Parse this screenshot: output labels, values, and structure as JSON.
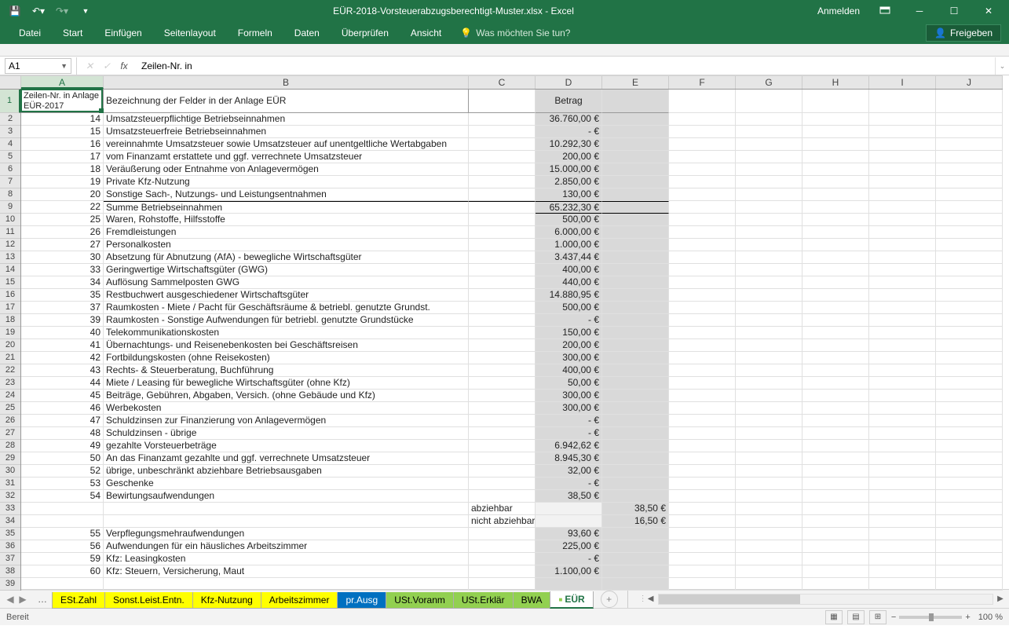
{
  "titlebar": {
    "title": "EÜR-2018-Vorsteuerabzugsberechtigt-Muster.xlsx  -  Excel",
    "login": "Anmelden"
  },
  "ribbon": {
    "tabs": [
      "Datei",
      "Start",
      "Einfügen",
      "Seitenlayout",
      "Formeln",
      "Daten",
      "Überprüfen",
      "Ansicht"
    ],
    "tell_me": "Was möchten Sie tun?",
    "share": "Freigeben"
  },
  "formula": {
    "name": "A1",
    "value": "Zeilen-Nr. in"
  },
  "columns": [
    "A",
    "B",
    "C",
    "D",
    "E",
    "F",
    "G",
    "H",
    "I",
    "J"
  ],
  "col_widths": [
    "col-A",
    "col-B",
    "col-C",
    "col-D",
    "col-E",
    "col-F",
    "col-G",
    "col-H",
    "col-I",
    "col-J"
  ],
  "header_row": {
    "A": "Zeilen-Nr. in Anlage EÜR-2017",
    "B": "Bezeichnung der Felder in der Anlage EÜR",
    "D": "Betrag"
  },
  "rows": [
    {
      "n": 2,
      "A": "14",
      "B": "Umsatzsteuerpflichtige Betriebseinnahmen",
      "D": "36.760,00 €"
    },
    {
      "n": 3,
      "A": "15",
      "B": "Umsatzsteuerfreie Betriebseinnahmen",
      "D": "-   €"
    },
    {
      "n": 4,
      "A": "16",
      "B": "vereinnahmte Umsatzsteuer sowie Umsatzsteuer auf unentgeltliche Wertabgaben",
      "D": "10.292,30 €"
    },
    {
      "n": 5,
      "A": "17",
      "B": "vom Finanzamt erstattete und ggf. verrechnete Umsatzsteuer",
      "D": "200,00 €"
    },
    {
      "n": 6,
      "A": "18",
      "B": "Veräußerung oder Entnahme von Anlagevermögen",
      "D": "15.000,00 €"
    },
    {
      "n": 7,
      "A": "19",
      "B": "Private Kfz-Nutzung",
      "D": "2.850,00 €"
    },
    {
      "n": 8,
      "A": "20",
      "B": "Sonstige Sach-, Nutzungs- und Leistungsentnahmen",
      "D": "130,00 €"
    },
    {
      "n": 9,
      "A": "22",
      "B": "Summe Betriebseinnahmen",
      "D": "65.232,30 €",
      "sum": true
    },
    {
      "n": 10,
      "A": "25",
      "B": "Waren, Rohstoffe, Hilfsstoffe",
      "D": "500,00 €"
    },
    {
      "n": 11,
      "A": "26",
      "B": "Fremdleistungen",
      "D": "6.000,00 €"
    },
    {
      "n": 12,
      "A": "27",
      "B": "Personalkosten",
      "D": "1.000,00 €"
    },
    {
      "n": 13,
      "A": "30",
      "B": "Absetzung für Abnutzung (AfA) - bewegliche Wirtschaftsgüter",
      "D": "3.437,44 €"
    },
    {
      "n": 14,
      "A": "33",
      "B": "Geringwertige Wirtschaftsgüter (GWG)",
      "D": "400,00 €"
    },
    {
      "n": 15,
      "A": "34",
      "B": "Auflösung Sammelposten GWG",
      "D": "440,00 €"
    },
    {
      "n": 16,
      "A": "35",
      "B": "Restbuchwert ausgeschiedener Wirtschaftsgüter",
      "D": "14.880,95 €"
    },
    {
      "n": 17,
      "A": "37",
      "B": "Raumkosten - Miete / Pacht für Geschäftsräume & betriebl. genutzte Grundst.",
      "D": "500,00 €"
    },
    {
      "n": 18,
      "A": "39",
      "B": "Raumkosten - Sonstige Aufwendungen für betriebl. genutzte Grundstücke",
      "D": "-   €"
    },
    {
      "n": 19,
      "A": "40",
      "B": "Telekommunikationskosten",
      "D": "150,00 €"
    },
    {
      "n": 20,
      "A": "41",
      "B": "Übernachtungs- und Reisenebenkosten bei Geschäftsreisen",
      "D": "200,00 €"
    },
    {
      "n": 21,
      "A": "42",
      "B": "Fortbildungskosten (ohne Reisekosten)",
      "D": "300,00 €"
    },
    {
      "n": 22,
      "A": "43",
      "B": "Rechts- & Steuerberatung, Buchführung",
      "D": "400,00 €"
    },
    {
      "n": 23,
      "A": "44",
      "B": "Miete / Leasing für bewegliche Wirtschaftsgüter (ohne Kfz)",
      "D": "50,00 €"
    },
    {
      "n": 24,
      "A": "45",
      "B": "Beiträge, Gebühren, Abgaben, Versich. (ohne Gebäude und Kfz)",
      "D": "300,00 €"
    },
    {
      "n": 25,
      "A": "46",
      "B": "Werbekosten",
      "D": "300,00 €"
    },
    {
      "n": 26,
      "A": "47",
      "B": "Schuldzinsen zur Finanzierung von Anlagevermögen",
      "D": "-   €"
    },
    {
      "n": 27,
      "A": "48",
      "B": "Schuldzinsen - übrige",
      "D": "-   €"
    },
    {
      "n": 28,
      "A": "49",
      "B": "gezahlte Vorsteuerbeträge",
      "D": "6.942,62 €"
    },
    {
      "n": 29,
      "A": "50",
      "B": "An das Finanzamt gezahlte und ggf. verrechnete Umsatzsteuer",
      "D": "8.945,30 €"
    },
    {
      "n": 30,
      "A": "52",
      "B": "übrige, unbeschränkt abziehbare Betriebsausgaben",
      "D": "32,00 €"
    },
    {
      "n": 31,
      "A": "53",
      "B": "Geschenke",
      "D": "-   €"
    },
    {
      "n": 32,
      "A": "54",
      "B": "Bewirtungsaufwendungen",
      "D": "38,50 €"
    },
    {
      "n": 33,
      "A": "",
      "B": "",
      "C": "abziehbar",
      "D": "",
      "E": "38,50 €",
      "shaded": true
    },
    {
      "n": 34,
      "A": "",
      "B": "",
      "C": "nicht abziehbar",
      "D": "",
      "E": "16,50 €",
      "shaded": true
    },
    {
      "n": 35,
      "A": "55",
      "B": "Verpflegungsmehraufwendungen",
      "D": "93,60 €"
    },
    {
      "n": 36,
      "A": "56",
      "B": "Aufwendungen für ein häusliches Arbeitszimmer",
      "D": "225,00 €"
    },
    {
      "n": 37,
      "A": "59",
      "B": "Kfz: Leasingkosten",
      "D": "-   €"
    },
    {
      "n": 38,
      "A": "60",
      "B": "Kfz: Steuern, Versicherung, Maut",
      "D": "1.100,00 €"
    }
  ],
  "sheets": [
    {
      "name": "ESt.Zahl",
      "cls": "yellow"
    },
    {
      "name": "Sonst.Leist.Entn.",
      "cls": "yellow"
    },
    {
      "name": "Kfz-Nutzung",
      "cls": "yellow"
    },
    {
      "name": "Arbeitszimmer",
      "cls": "yellow"
    },
    {
      "name": "pr.Ausg",
      "cls": "blue"
    },
    {
      "name": "USt.Voranm",
      "cls": "green"
    },
    {
      "name": "USt.Erklär",
      "cls": "green"
    },
    {
      "name": "BWA",
      "cls": "green"
    },
    {
      "name": "EÜR",
      "cls": "active"
    }
  ],
  "status": {
    "ready": "Bereit",
    "zoom": "100 %"
  }
}
